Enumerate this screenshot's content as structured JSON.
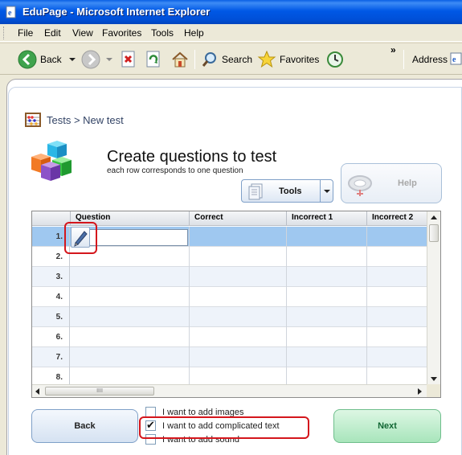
{
  "window": {
    "title": "EduPage - Microsoft Internet Explorer"
  },
  "menu": [
    "File",
    "Edit",
    "View",
    "Favorites",
    "Tools",
    "Help"
  ],
  "toolbar": {
    "back_label": "Back",
    "search_label": "Search",
    "favorites_label": "Favorites",
    "more": "»",
    "address_label": "Address"
  },
  "page": {
    "breadcrumb": "Tests > New test",
    "title": "Create questions to test",
    "subtitle": "each row corresponds to one question",
    "tools_label": "Tools",
    "help_label": "Help"
  },
  "grid": {
    "columns": [
      "Question",
      "Correct",
      "Incorrect 1",
      "Incorrect 2"
    ],
    "rows": [
      "1.",
      "2.",
      "3.",
      "4.",
      "5.",
      "6.",
      "7.",
      "8."
    ],
    "scroll_grip": "IIII"
  },
  "options": {
    "images": "I want to add images",
    "complicated_text": "I want to add complicated text",
    "sound": "I want to add sound",
    "images_checked": false,
    "complicated_text_checked": true,
    "sound_checked": false
  },
  "buttons": {
    "back": "Back",
    "next": "Next"
  },
  "colors": {
    "highlight": "#D4161C",
    "titlebar": "#0058E6",
    "selected_row": "#9FC8F0"
  }
}
